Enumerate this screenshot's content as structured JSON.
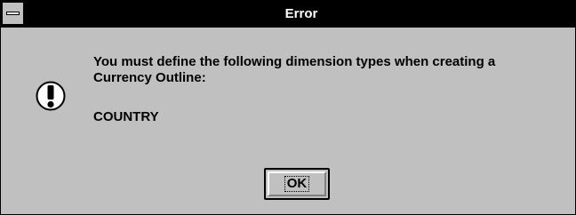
{
  "window": {
    "title": "Error"
  },
  "dialog": {
    "icon": "exclamation-icon",
    "message_line1": "You must define the following dimension types when creating a",
    "message_line2": "Currency Outline:",
    "detail": "COUNTRY"
  },
  "buttons": {
    "ok_label": "OK"
  },
  "colors": {
    "titlebar": "#000000",
    "title_text": "#ffffff",
    "face": "#c0c0c0"
  }
}
